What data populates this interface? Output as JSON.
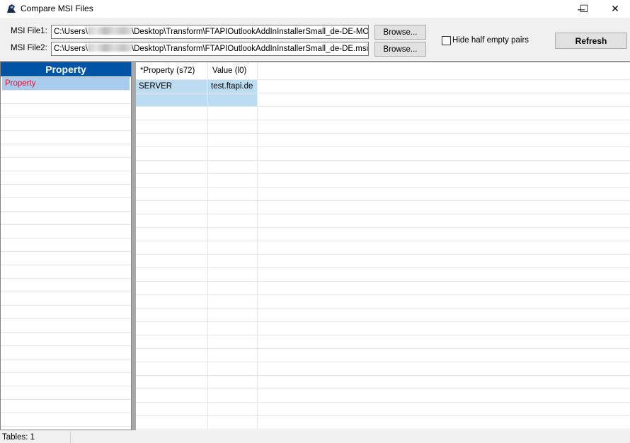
{
  "window": {
    "title": "Compare MSI Files",
    "minimize": "─",
    "maximize": "☐",
    "close": "✕"
  },
  "toolbar": {
    "file1_label": "MSI File1:",
    "file1_prefix": "C:\\Users\\",
    "file1_suffix": "\\Desktop\\Transform\\FTAPIOutlookAddInInstallerSmall_de-DE-MODIFIED",
    "file2_label": "MSI File2:",
    "file2_prefix": "C:\\Users\\",
    "file2_suffix": "\\Desktop\\Transform\\FTAPIOutlookAddInInstallerSmall_de-DE.msi",
    "browse_label": "Browse...",
    "hide_half_empty_label": "Hide half empty pairs",
    "hide_half_empty_checked": false,
    "refresh_label": "Refresh"
  },
  "tables": {
    "header": "Property",
    "items": [
      {
        "label": "Property",
        "selected": true,
        "color": "#e8102a"
      }
    ]
  },
  "grid": {
    "columns": [
      "*Property  (s72)",
      "Value  (l0)"
    ],
    "rows": [
      [
        "SERVER",
        "test.ftapi.de"
      ],
      [
        "",
        ""
      ]
    ]
  },
  "status": {
    "tables": "Tables: 1"
  },
  "colors": {
    "header_blue": "#0054a6",
    "row_highlight": "#bcdcf2",
    "selected": "#a9cbee"
  }
}
